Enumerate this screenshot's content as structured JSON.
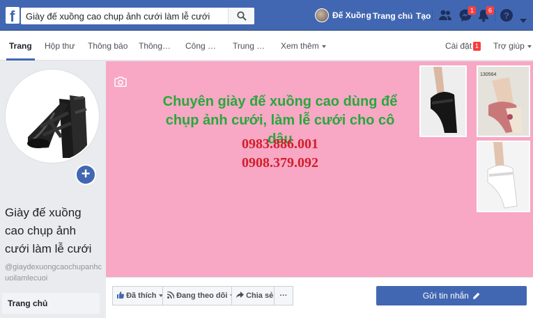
{
  "topbar": {
    "search_value": "Giày đế xuồng cao chụp ảnh cưới làm lễ cưới",
    "user_name": "Đế Xuồng",
    "home_label": "Trang chủ",
    "create_label": "Tạo",
    "messages_badge": "1",
    "notifications_badge": "6",
    "brand_color": "#4267b2"
  },
  "tabs": {
    "page": "Trang",
    "inbox": "Hộp thư",
    "notifications": "Thông báo",
    "insights": "Thông…",
    "tools": "Công …",
    "center": "Trung …",
    "more": "Xem thêm",
    "settings": "Cài đặt",
    "settings_badge": "1",
    "help": "Trợ giúp"
  },
  "sidebar": {
    "page_name": "Giày đế xuồng cao chụp ảnh cưới làm lễ cưới",
    "handle": "@giaydexuongcaochupanhcuoilamlecuoi",
    "home": "Trang chủ"
  },
  "cover": {
    "headline_line1": "Chuyên giày đế xuồng cao dùng để",
    "headline_line2": "chụp ảnh cưới, làm lễ cưới cho cô dâu",
    "phone1": "0983.886.001",
    "phone2": "0908.379.092",
    "thumb_code": "130564"
  },
  "actions": {
    "like": "Đã thích",
    "follow": "Đang theo dõi",
    "share": "Chia sẻ",
    "more": "···",
    "send_message": "Gửi tin nhắn"
  }
}
